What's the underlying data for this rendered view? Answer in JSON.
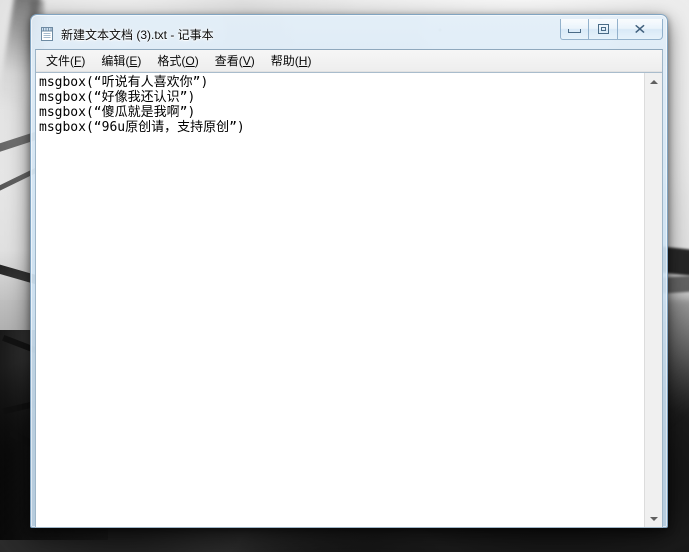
{
  "desktop": {
    "wallpaper_description": "grayscale abstract photo, light at top, dark at bottom"
  },
  "window": {
    "title": "新建文本文档 (3).txt - 记事本",
    "icon": "notepad-icon",
    "controls": {
      "minimize_label": "最小化",
      "maximize_label": "还原",
      "close_label": "关闭",
      "close_glyph": "✕"
    }
  },
  "menu": {
    "items": [
      {
        "label": "文件",
        "accelerator": "F"
      },
      {
        "label": "编辑",
        "accelerator": "E"
      },
      {
        "label": "格式",
        "accelerator": "O"
      },
      {
        "label": "查看",
        "accelerator": "V"
      },
      {
        "label": "帮助",
        "accelerator": "H"
      }
    ]
  },
  "document": {
    "lines": [
      "msgbox(“听说有人喜欢你”)",
      "msgbox(“好像我还认识”)",
      "msgbox(“傻瓜就是我啊”)",
      "msgbox(“96u原创请，支持原创”)"
    ]
  },
  "scrollbar": {
    "up_arrow": "scroll-up-arrow",
    "down_arrow": "scroll-down-arrow"
  },
  "colors": {
    "aero_frame": "#d0e4f4",
    "client_bg": "#f0f0f0",
    "text_bg": "#ffffff",
    "text_fg": "#000000"
  }
}
